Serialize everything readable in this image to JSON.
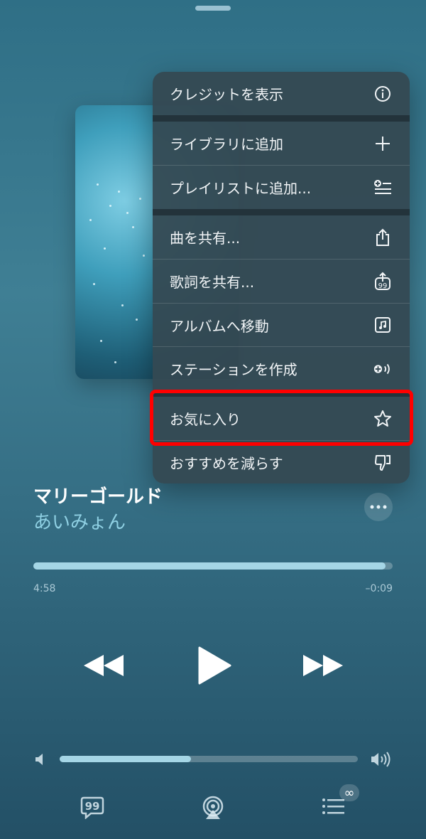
{
  "menu": {
    "items": [
      {
        "label": "クレジットを表示",
        "icon": "info-icon"
      },
      {
        "label": "ライブラリに追加",
        "icon": "plus-icon"
      },
      {
        "label": "プレイリストに追加...",
        "icon": "add-to-playlist-icon"
      },
      {
        "label": "曲を共有...",
        "icon": "share-icon"
      },
      {
        "label": "歌詞を共有...",
        "icon": "share-lyrics-icon"
      },
      {
        "label": "アルバムへ移動",
        "icon": "album-icon"
      },
      {
        "label": "ステーションを作成",
        "icon": "station-icon"
      },
      {
        "label": "お気に入り",
        "icon": "star-icon"
      },
      {
        "label": "おすすめを減らす",
        "icon": "thumbs-down-icon"
      }
    ]
  },
  "now_playing": {
    "title": "マリーゴールド",
    "artist": "あいみょん",
    "elapsed": "4:58",
    "remaining": "–0:09",
    "progress_fraction": 0.98,
    "volume_fraction": 0.44
  },
  "colors": {
    "highlight": "#ff0000",
    "accent": "#8fd0e3"
  },
  "queue_badge": "∞"
}
